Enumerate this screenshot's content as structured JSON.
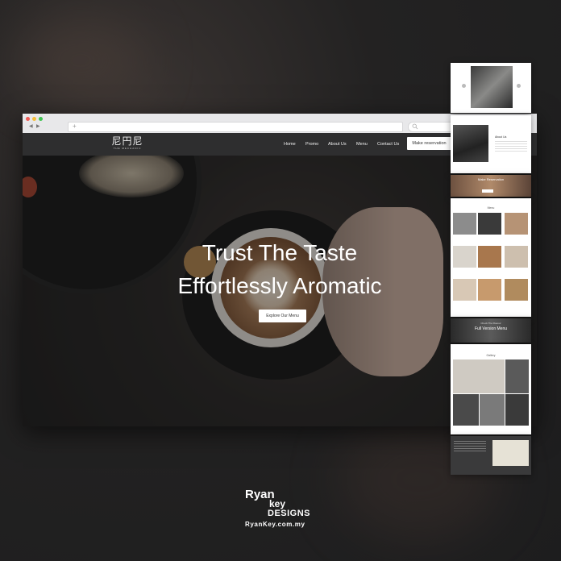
{
  "site": {
    "logo_mark": "尼円尼",
    "logo_sub": "THE MECHANIC",
    "nav": [
      "Home",
      "Promo",
      "About Us",
      "Menu",
      "Contact Us"
    ],
    "reserve_label": "Make reservation"
  },
  "hero": {
    "title_line1": "Trust The Taste",
    "title_line2": "Effortlessly Aromatic",
    "button_label": "Explore Our Menu"
  },
  "preview": {
    "about_heading": "About Us",
    "reservation_heading": "Make Reservation",
    "menu_heading": "Menu",
    "full_menu_heading": "Full Version Menu",
    "full_menu_sub": "Check The Flavour",
    "gallery_heading": "Gallery"
  },
  "brand": {
    "line1": "Ryan",
    "line2": "key",
    "line3": "DESIGNS",
    "url": "RyanKey.com.my"
  }
}
